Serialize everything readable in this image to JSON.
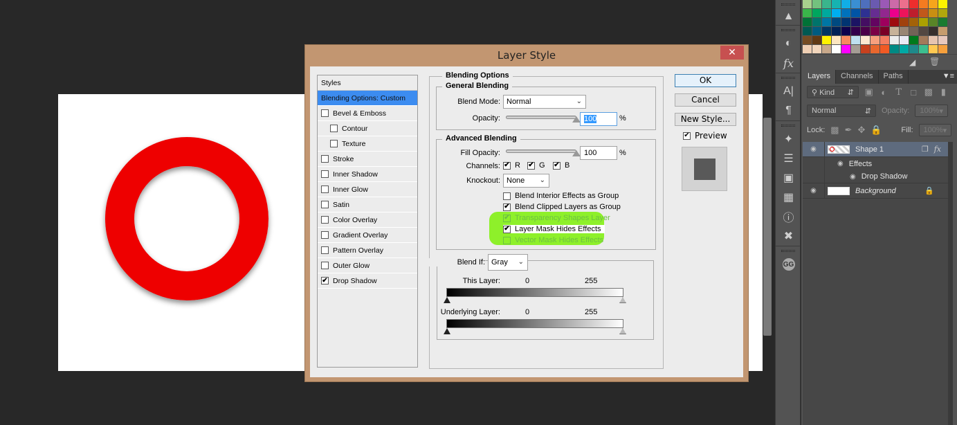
{
  "dialog": {
    "title": "Layer Style",
    "close_label": "✕",
    "styles_header": "Styles",
    "styles": [
      {
        "label": "Blending Options: Custom",
        "selected": true,
        "has_checkbox": false,
        "indent": false,
        "checked": false
      },
      {
        "label": "Bevel & Emboss",
        "has_checkbox": true,
        "indent": false,
        "checked": false
      },
      {
        "label": "Contour",
        "has_checkbox": true,
        "indent": true,
        "checked": false
      },
      {
        "label": "Texture",
        "has_checkbox": true,
        "indent": true,
        "checked": false
      },
      {
        "label": "Stroke",
        "has_checkbox": true,
        "indent": false,
        "checked": false
      },
      {
        "label": "Inner Shadow",
        "has_checkbox": true,
        "indent": false,
        "checked": false
      },
      {
        "label": "Inner Glow",
        "has_checkbox": true,
        "indent": false,
        "checked": false
      },
      {
        "label": "Satin",
        "has_checkbox": true,
        "indent": false,
        "checked": false
      },
      {
        "label": "Color Overlay",
        "has_checkbox": true,
        "indent": false,
        "checked": false
      },
      {
        "label": "Gradient Overlay",
        "has_checkbox": true,
        "indent": false,
        "checked": false
      },
      {
        "label": "Pattern Overlay",
        "has_checkbox": true,
        "indent": false,
        "checked": false
      },
      {
        "label": "Outer Glow",
        "has_checkbox": true,
        "indent": false,
        "checked": false
      },
      {
        "label": "Drop Shadow",
        "has_checkbox": true,
        "indent": false,
        "checked": true
      }
    ],
    "blending_options_title": "Blending Options",
    "general": {
      "title": "General Blending",
      "blend_mode_label": "Blend Mode:",
      "blend_mode_value": "Normal",
      "opacity_label": "Opacity:",
      "opacity_value": "100",
      "opacity_percent": 100,
      "percent_sign": "%"
    },
    "advanced": {
      "title": "Advanced Blending",
      "fill_opacity_label": "Fill Opacity:",
      "fill_opacity_value": "100",
      "fill_opacity_percent": 100,
      "percent_sign": "%",
      "channels_label": "Channels:",
      "channels": [
        {
          "label": "R",
          "checked": true
        },
        {
          "label": "G",
          "checked": true
        },
        {
          "label": "B",
          "checked": true
        }
      ],
      "knockout_label": "Knockout:",
      "knockout_value": "None",
      "options": [
        {
          "label": "Blend Interior Effects as Group",
          "checked": false,
          "disabled": false
        },
        {
          "label": "Blend Clipped Layers as Group",
          "checked": true,
          "disabled": false
        },
        {
          "label": "Transparency Shapes Layer",
          "checked": true,
          "disabled": true
        },
        {
          "label": "Layer Mask Hides Effects",
          "checked": true,
          "disabled": false
        },
        {
          "label": "Vector Mask Hides Effects",
          "checked": false,
          "disabled": true
        }
      ],
      "highlight_color": "#8ef02a"
    },
    "blend_if": {
      "label": "Blend If:",
      "value": "Gray",
      "this_layer_label": "This Layer:",
      "this_layer_min": "0",
      "this_layer_max": "255",
      "underlying_label": "Underlying Layer:",
      "underlying_min": "0",
      "underlying_max": "255"
    },
    "buttons": {
      "ok": "OK",
      "cancel": "Cancel",
      "new_style": "New Style..."
    },
    "preview_label": "Preview",
    "preview_checked": true,
    "title_bar_color": "#c29671",
    "accent_color": "#3c8cf0"
  },
  "canvas": {
    "shape_color": "#ee0000",
    "background_color": "#ffffff"
  },
  "layers_panel": {
    "tabs": [
      "Layers",
      "Channels",
      "Paths"
    ],
    "active_tab": "Layers",
    "filter_kind": "Kind",
    "blend_mode": "Normal",
    "opacity_label": "Opacity:",
    "opacity_value": "100%",
    "lock_label": "Lock:",
    "fill_label": "Fill:",
    "fill_value": "100%",
    "layers": [
      {
        "name": "Shape 1",
        "selected": true,
        "has_fx": true
      },
      {
        "name": "Effects",
        "sub": 1
      },
      {
        "name": "Drop Shadow",
        "sub": 2
      },
      {
        "name": "Background",
        "italic": true,
        "locked": true
      }
    ]
  },
  "swatches": [
    "#a8d08d",
    "#73c27e",
    "#3ab58c",
    "#16b3b1",
    "#11aee6",
    "#3a8fd2",
    "#4e6fbd",
    "#6a5ab0",
    "#9b59b6",
    "#cc6aa8",
    "#ec6f8c",
    "#ee2d2d",
    "#f57b20",
    "#f7a51c",
    "#fef200",
    "#3ab54a",
    "#00a65e",
    "#00a99d",
    "#00aeef",
    "#0072bc",
    "#0054a6",
    "#2e3192",
    "#662d91",
    "#92278f",
    "#ec008c",
    "#ed145b",
    "#be1e2d",
    "#c1581b",
    "#c98f12",
    "#b1a70c",
    "#007236",
    "#00746b",
    "#0076a3",
    "#004a80",
    "#003471",
    "#1b1464",
    "#440e62",
    "#630460",
    "#9e005d",
    "#9e0b0f",
    "#a0410d",
    "#a36209",
    "#aba000",
    "#598527",
    "#1a7b30",
    "#005952",
    "#005b7f",
    "#003663",
    "#002157",
    "#0d004c",
    "#32004b",
    "#4b0049",
    "#7b0046",
    "#7a0026",
    "#c7b299",
    "#998675",
    "#736357",
    "#534741",
    "#362f2d",
    "#c69c6d",
    "#754c24",
    "#603913",
    "#fff200",
    "#fde6c0",
    "#f7885e",
    "#bfe0f0",
    "#fde8d0",
    "#f7a07e",
    "#f47d60",
    "#ececec",
    "#eaeaf5",
    "#007a1c",
    "#a37a5a",
    "#e6c4b0",
    "#e8c8bd",
    "#efcfb4",
    "#f2d6bc",
    "#c9a98b",
    "#ffffff",
    "#ff00ff",
    "#a59d95",
    "#c8411e",
    "#e8672e",
    "#f15a24",
    "#008a84",
    "#00a9a4",
    "#1e8a8a",
    "#3cbf8f",
    "#ffc952",
    "#f7a03c"
  ]
}
